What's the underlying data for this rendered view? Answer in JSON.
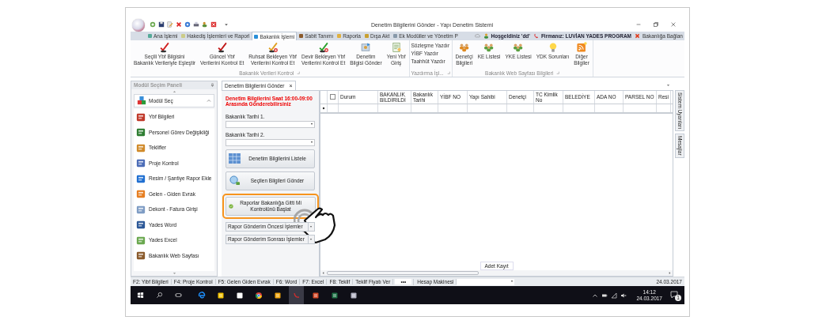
{
  "window": {
    "title": "Denetim Bilgilerini Gönder - Yapı Denetim Sistemi"
  },
  "ribbon_tabs": [
    {
      "label": "Ana İşlemi",
      "selected": false
    },
    {
      "label": "Hakediş İşlemleri ve Raporl",
      "selected": false
    },
    {
      "label": "Bakanlık İşlemi",
      "selected": true
    },
    {
      "label": "Sabit Tanımı",
      "selected": false
    },
    {
      "label": "Raporla",
      "selected": false
    },
    {
      "label": "Dışa Akt",
      "selected": false
    },
    {
      "label": "Ek Modüller ve Yönetim P",
      "selected": false
    }
  ],
  "header_info": {
    "welcome": "Hoşgeldiniz 'dd'",
    "company": "Firmanız: LUVİAN YADES PROGRAM",
    "connect": "Bakanlığa Bağlan"
  },
  "ribbon_groups": [
    {
      "title": "Bakanlık Verileri Kontrol",
      "kind": "large",
      "buttons": [
        {
          "lines": [
            "Seçili Ybf Bilgisini",
            "Bakanlık Verileriyle Eşleştir"
          ]
        },
        {
          "lines": [
            "Güncel Ybf",
            "Verilerini Kontrol Et"
          ]
        },
        {
          "lines": [
            "Ruhsat Bekleyen Ybf",
            "Verilerini Kontrol Et"
          ]
        },
        {
          "lines": [
            "Devir Bekleyen Ybf",
            "Verilerini Kontrol Et"
          ]
        },
        {
          "lines": [
            "Denetim",
            "Bilgisi Gönder"
          ]
        },
        {
          "lines": [
            "Yeni Ybf",
            "Giriş"
          ]
        }
      ]
    },
    {
      "title": "Yazdırma İşl...",
      "kind": "small",
      "buttons": [
        {
          "lines": [
            "Sözleşme Yazdır"
          ]
        },
        {
          "lines": [
            "YİBF Yazdır"
          ]
        },
        {
          "lines": [
            "Taahhüt Yazdır"
          ]
        }
      ]
    },
    {
      "title": "Bakanlık Web Sayfası Bilgileri",
      "kind": "large",
      "buttons": [
        {
          "lines": [
            "Denetçi",
            "Bilgileri"
          ]
        },
        {
          "lines": [
            "KE Listesi"
          ]
        },
        {
          "lines": [
            "YKE Listesi"
          ]
        },
        {
          "lines": [
            "YDK Sorunları"
          ]
        },
        {
          "lines": [
            "Diğer",
            "Bilgiler"
          ]
        }
      ]
    }
  ],
  "module_panel": {
    "title": "Modül Seçim Paneli",
    "header": "Modül Seç",
    "items": [
      "Ybf Bilgileri",
      "Personel Görev Değişikliği",
      "Teklifler",
      "Proje Kontrol",
      "Resim / Şantiye Rapor Ekle",
      "Gelen - Giden Evrak",
      "Dekont - Fatura Girişi",
      "Yades Word",
      "Yades Excel",
      "Bakanlık Web Sayfası"
    ]
  },
  "document_tab": {
    "label": "Denetim Bilgilerini Gönder",
    "close": "×"
  },
  "form": {
    "warning": "Denetim Bilgilerini Saat 16:00-09:00 Arasında Gönderebilirsiniz",
    "fields": [
      {
        "label": "Bakanlık Tarihi 1."
      },
      {
        "label": "Bakanlık Tarihi 2."
      }
    ],
    "buttons": [
      {
        "label": "Denetim Bilgilerini Listele",
        "highlighted": false
      },
      {
        "label": "Seçilen Bilgileri Gönder",
        "highlighted": false
      },
      {
        "label": "Raporlar Bakanlığa Gitti Mi Kontrolünü Başlat",
        "highlighted": true
      }
    ],
    "menus": [
      "Rapor Gönderim Öncesi İşlemler",
      "Rapor Gönderim Sonrası İşlemler"
    ]
  },
  "grid": {
    "select_all_checked": false,
    "columns": [
      "Durum",
      "BAKANLIK BİLDİRİLDİ",
      "Bakanlık Tarihi",
      "YİBF NO",
      "Yapı Sahibi",
      "Denetçi",
      "TC Kimlik No",
      "BELEDİYE",
      "ADA NO",
      "PARSEL NO",
      "Resi"
    ],
    "footer": "Adet Kayıt"
  },
  "side_tabs": [
    "Sistem Uyarıları",
    "Mesajlar"
  ],
  "status_bar": {
    "items": [
      "F2: Yibf Bilgileri",
      "F4: Proje Kontrol",
      "F5: Gelen Giden Evrak",
      "F6: Word",
      "F7: Excel",
      "F8: Teklif",
      "Teklif Fiyatı Ver"
    ],
    "more": "•••",
    "calculator": "Hesap Makinesi",
    "date": "24.03.2017"
  },
  "taskbar": {
    "apps": [
      {
        "selected": false
      },
      {
        "selected": false
      },
      {
        "selected": false
      },
      {
        "selected": false
      },
      {
        "selected": false
      },
      {
        "selected": true
      },
      {
        "selected": false
      },
      {
        "selected": false
      },
      {
        "selected": false
      }
    ],
    "time": "14:12",
    "date": "24.03.2017",
    "notifications": "1"
  }
}
